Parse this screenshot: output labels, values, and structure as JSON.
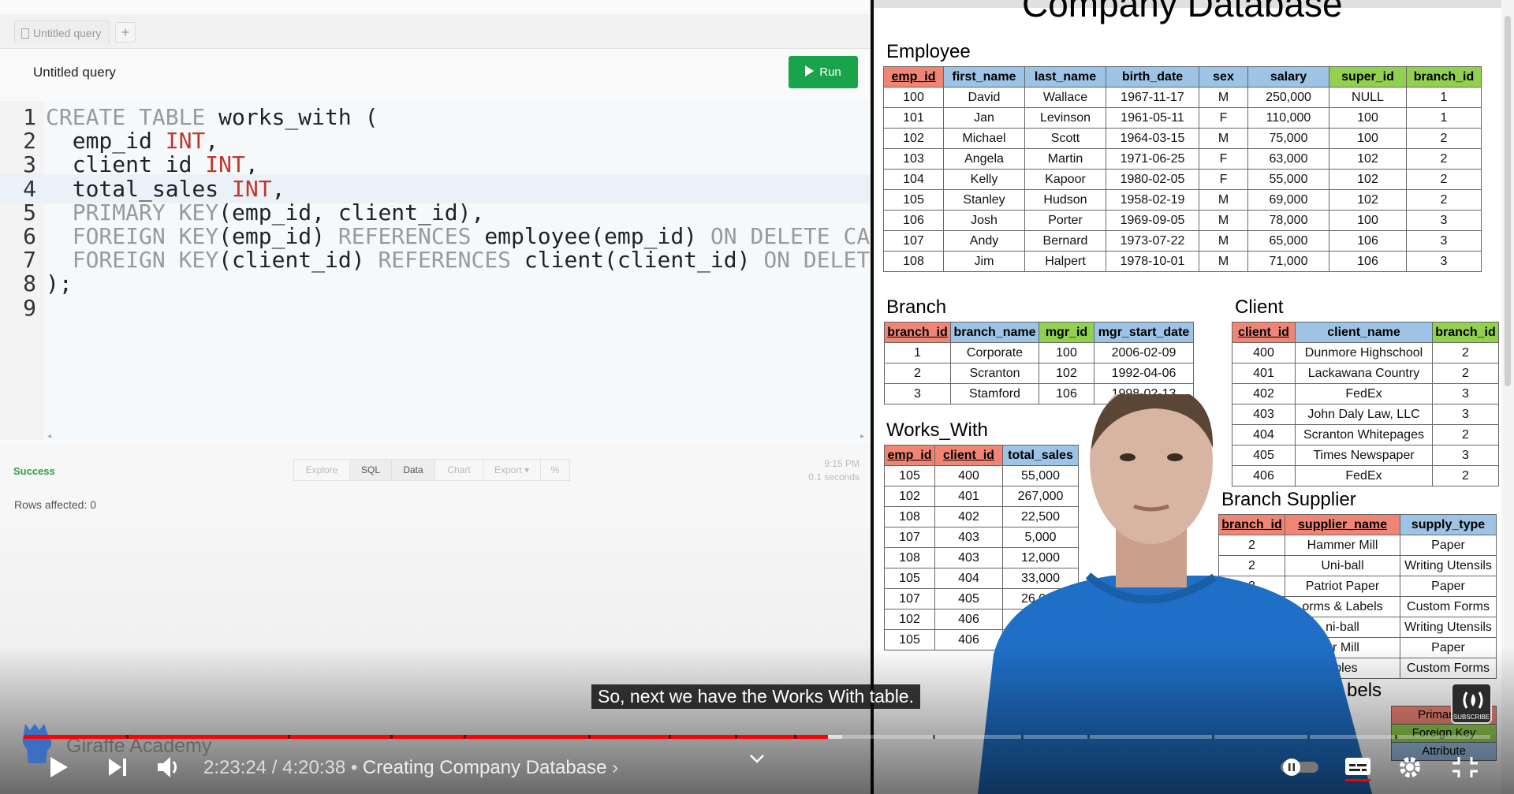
{
  "editor": {
    "tab_label": "Untitled query",
    "add_tab_label": "+",
    "query_title": "Untitled query",
    "run_label": "Run",
    "code": [
      {
        "n": "1",
        "tokens": [
          [
            "kw",
            "CREATE TABLE "
          ],
          [
            "tx",
            "works_with ("
          ]
        ]
      },
      {
        "n": "2",
        "tokens": [
          [
            "tx",
            "  emp_id "
          ],
          [
            "ty",
            "INT"
          ],
          [
            "tx",
            ","
          ]
        ]
      },
      {
        "n": "3",
        "tokens": [
          [
            "tx",
            "  client_id "
          ],
          [
            "ty",
            "INT"
          ],
          [
            "tx",
            ","
          ]
        ]
      },
      {
        "n": "4",
        "tokens": [
          [
            "tx",
            "  total_sales "
          ],
          [
            "ty",
            "INT"
          ],
          [
            "tx",
            ","
          ]
        ]
      },
      {
        "n": "5",
        "tokens": [
          [
            "kw",
            "  PRIMARY KEY"
          ],
          [
            "tx",
            "(emp_id, client_id),"
          ]
        ]
      },
      {
        "n": "6",
        "tokens": [
          [
            "kw",
            "  FOREIGN KEY"
          ],
          [
            "tx",
            "(emp_id) "
          ],
          [
            "kw",
            "REFERENCES "
          ],
          [
            "tx",
            "employee(emp_id) "
          ],
          [
            "kw",
            "ON DELETE CA"
          ]
        ]
      },
      {
        "n": "7",
        "tokens": [
          [
            "kw",
            "  FOREIGN KEY"
          ],
          [
            "tx",
            "(client_id) "
          ],
          [
            "kw",
            "REFERENCES "
          ],
          [
            "tx",
            "client(client_id) "
          ],
          [
            "kw",
            "ON DELET"
          ]
        ]
      },
      {
        "n": "8",
        "tokens": [
          [
            "tx",
            ");"
          ]
        ]
      },
      {
        "n": "9",
        "tokens": []
      }
    ],
    "active_line": 4
  },
  "results": {
    "status": "Success",
    "buttons": [
      "Explore",
      "SQL",
      "Data",
      "Chart",
      "Export ▾",
      "%"
    ],
    "active_button": "Data",
    "time": "9:15 PM",
    "duration": "0.1 seconds",
    "rows_affected": "Rows affected: 0"
  },
  "database": {
    "title": "Company Database",
    "employee": {
      "title": "Employee",
      "columns": [
        [
          "emp_id",
          "pk"
        ],
        [
          "first_name",
          "at"
        ],
        [
          "last_name",
          "at"
        ],
        [
          "birth_date",
          "at"
        ],
        [
          "sex",
          "at"
        ],
        [
          "salary",
          "at"
        ],
        [
          "super_id",
          "fk"
        ],
        [
          "branch_id",
          "fk"
        ]
      ],
      "rows": [
        [
          "100",
          "David",
          "Wallace",
          "1967-11-17",
          "M",
          "250,000",
          "NULL",
          "1"
        ],
        [
          "101",
          "Jan",
          "Levinson",
          "1961-05-11",
          "F",
          "110,000",
          "100",
          "1"
        ],
        [
          "102",
          "Michael",
          "Scott",
          "1964-03-15",
          "M",
          "75,000",
          "100",
          "2"
        ],
        [
          "103",
          "Angela",
          "Martin",
          "1971-06-25",
          "F",
          "63,000",
          "102",
          "2"
        ],
        [
          "104",
          "Kelly",
          "Kapoor",
          "1980-02-05",
          "F",
          "55,000",
          "102",
          "2"
        ],
        [
          "105",
          "Stanley",
          "Hudson",
          "1958-02-19",
          "M",
          "69,000",
          "102",
          "2"
        ],
        [
          "106",
          "Josh",
          "Porter",
          "1969-09-05",
          "M",
          "78,000",
          "100",
          "3"
        ],
        [
          "107",
          "Andy",
          "Bernard",
          "1973-07-22",
          "M",
          "65,000",
          "106",
          "3"
        ],
        [
          "108",
          "Jim",
          "Halpert",
          "1978-10-01",
          "M",
          "71,000",
          "106",
          "3"
        ]
      ]
    },
    "branch": {
      "title": "Branch",
      "columns": [
        [
          "branch_id",
          "pk"
        ],
        [
          "branch_name",
          "at"
        ],
        [
          "mgr_id",
          "fk"
        ],
        [
          "mgr_start_date",
          "at"
        ]
      ],
      "rows": [
        [
          "1",
          "Corporate",
          "100",
          "2006-02-09"
        ],
        [
          "2",
          "Scranton",
          "102",
          "1992-04-06"
        ],
        [
          "3",
          "Stamford",
          "106",
          "1998-02-13"
        ]
      ]
    },
    "client": {
      "title": "Client",
      "columns": [
        [
          "client_id",
          "pk"
        ],
        [
          "client_name",
          "at"
        ],
        [
          "branch_id",
          "fk"
        ]
      ],
      "rows": [
        [
          "400",
          "Dunmore Highschool",
          "2"
        ],
        [
          "401",
          "Lackawana Country",
          "2"
        ],
        [
          "402",
          "FedEx",
          "3"
        ],
        [
          "403",
          "John Daly Law, LLC",
          "3"
        ],
        [
          "404",
          "Scranton Whitepages",
          "2"
        ],
        [
          "405",
          "Times Newspaper",
          "3"
        ],
        [
          "406",
          "FedEx",
          "2"
        ]
      ]
    },
    "works_with": {
      "title": "Works_With",
      "columns": [
        [
          "emp_id",
          "pk"
        ],
        [
          "client_id",
          "pk"
        ],
        [
          "total_sales",
          "at"
        ]
      ],
      "rows": [
        [
          "105",
          "400",
          "55,000"
        ],
        [
          "102",
          "401",
          "267,000"
        ],
        [
          "108",
          "402",
          "22,500"
        ],
        [
          "107",
          "403",
          "5,000"
        ],
        [
          "108",
          "403",
          "12,000"
        ],
        [
          "105",
          "404",
          "33,000"
        ],
        [
          "107",
          "405",
          "26,000"
        ],
        [
          "102",
          "406",
          ""
        ],
        [
          "105",
          "406",
          ""
        ]
      ]
    },
    "branch_supplier": {
      "title": "Branch Supplier",
      "columns": [
        [
          "branch_id",
          "pk"
        ],
        [
          "supplier_name",
          "pk"
        ],
        [
          "supply_type",
          "at"
        ]
      ],
      "rows": [
        [
          "2",
          "Hammer Mill",
          "Paper"
        ],
        [
          "2",
          "Uni-ball",
          "Writing Utensils"
        ],
        [
          "3",
          "Patriot Paper",
          "Paper"
        ],
        [
          "",
          "orms & Labels",
          "Custom Forms"
        ],
        [
          "",
          "ni-ball",
          "Writing Utensils"
        ],
        [
          "",
          "er Mill",
          "Paper"
        ],
        [
          "",
          "ables",
          "Custom Forms"
        ]
      ]
    },
    "legend": {
      "title": "bels",
      "items": [
        [
          "Primary K",
          "#f08575"
        ],
        [
          "Foreign Key",
          "#92d050"
        ],
        [
          "Attribute",
          "#9dc3e6"
        ]
      ]
    }
  },
  "player": {
    "caption": "So, next we have the Works With table.",
    "watermark": "Giraffe Academy",
    "current_time": "2:23:24",
    "duration": "4:20:38",
    "chapter": "Creating Company Database",
    "played_fraction": 0.5485,
    "buffered_fraction": 0.558,
    "subscribe_label": "SUBSCRIBE",
    "accent": "#ff0000"
  }
}
